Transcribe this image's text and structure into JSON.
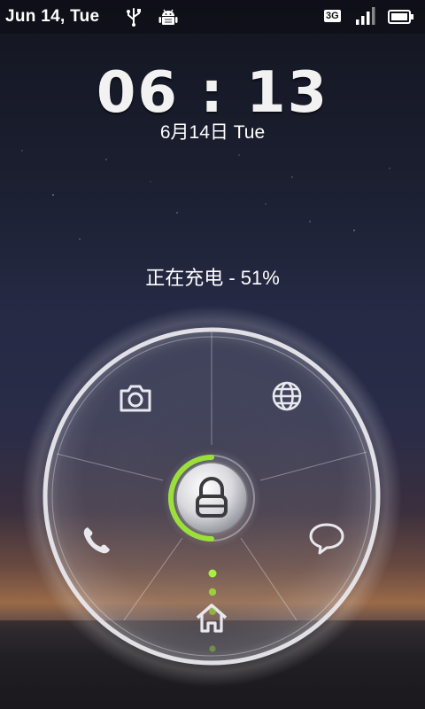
{
  "status_bar": {
    "date": "Jun 14, Tue",
    "network_label": "3G",
    "icons": [
      "usb-icon",
      "android-debug-icon",
      "network-3g-icon",
      "signal-icon",
      "battery-icon"
    ]
  },
  "clock": {
    "time": "06 : 13",
    "date": "6月14日 Tue"
  },
  "charging_status": "正在充电 - 51%",
  "unlock_ring": {
    "shortcuts": [
      "camera-icon",
      "browser-globe-icon",
      "phone-icon",
      "messaging-icon",
      "home-icon"
    ],
    "center": "lock-icon",
    "accent_color": "#9be03a"
  }
}
